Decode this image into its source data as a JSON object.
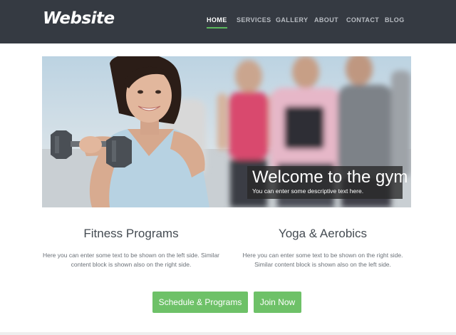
{
  "header": {
    "logo": "Website",
    "nav": [
      {
        "label": "HOME",
        "active": true
      },
      {
        "label": "SERVICES",
        "active": false
      },
      {
        "label": "GALLERY",
        "active": false
      },
      {
        "label": "ABOUT",
        "active": false
      },
      {
        "label": "CONTACT",
        "active": false
      },
      {
        "label": "BLOG",
        "active": false
      }
    ]
  },
  "hero": {
    "title": "Welcome to the gym",
    "text": "You can enter some descriptive text here."
  },
  "columns": [
    {
      "title": "Fitness Programs",
      "text": "Here you can enter some text to be shown on the left side. Similar content block is shown also on the right side."
    },
    {
      "title": "Yoga & Aerobics",
      "text": "Here you can enter some text to be shown on the right side. Similar content block is shown also on the left side."
    }
  ],
  "buttons": {
    "schedule": "Schedule & Programs",
    "join": "Join Now"
  },
  "colors": {
    "header_bg": "#353a42",
    "accent_green": "#6ec168",
    "nav_active_underline": "#5cb85c"
  }
}
